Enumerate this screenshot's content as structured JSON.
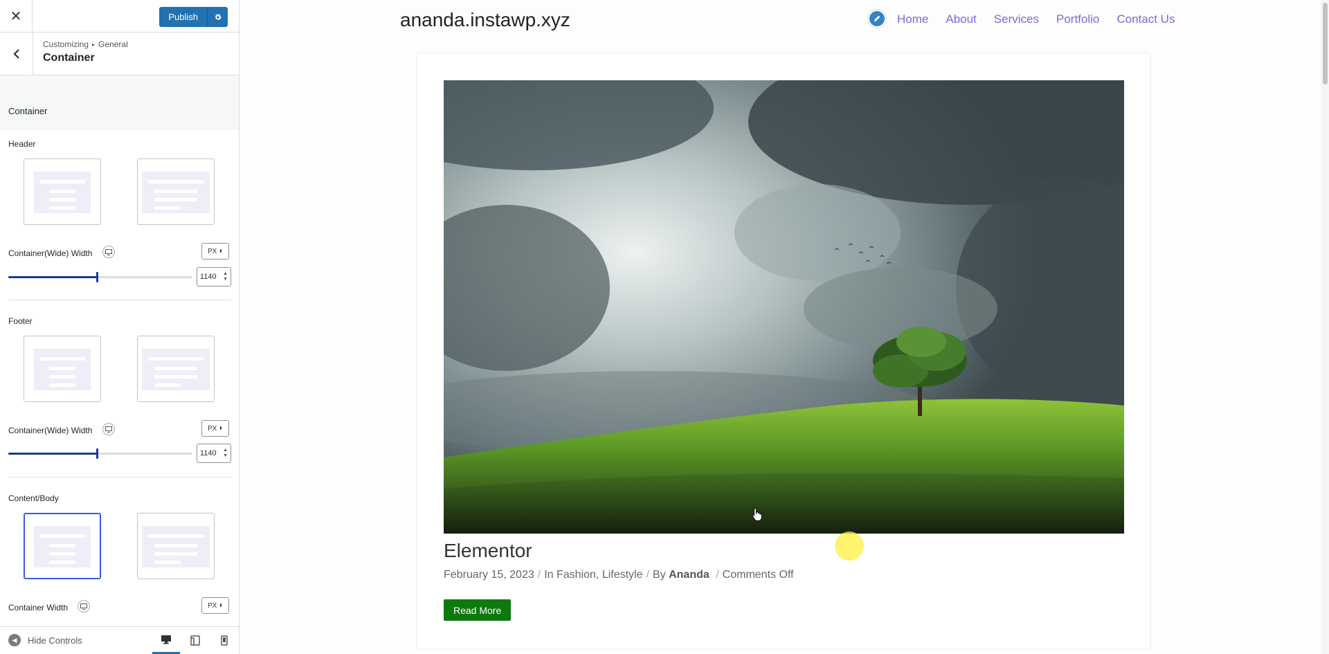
{
  "customizer": {
    "close_icon": "close-icon",
    "publish_label": "Publish",
    "breadcrumb_root": "Customizing",
    "breadcrumb_parent": "General",
    "section_title": "Container",
    "panel_heading": "Container",
    "header": {
      "label": "Header",
      "width_label": "Container(Wide) Width",
      "unit": "PX",
      "value": "1140",
      "slider_fraction": 0.48
    },
    "footer": {
      "label": "Footer",
      "width_label": "Container(Wide) Width",
      "unit": "PX",
      "value": "1140",
      "slider_fraction": 0.48
    },
    "content": {
      "label": "Content/Body",
      "width_label": "Container Width",
      "unit": "PX"
    },
    "hide_controls": "Hide Controls"
  },
  "site": {
    "title": "ananda.instawp.xyz",
    "nav": [
      "Home",
      "About",
      "Services",
      "Portfolio",
      "Contact Us"
    ]
  },
  "post": {
    "title": "Elementor",
    "date": "February 15, 2023",
    "in_prefix": "In",
    "categories": [
      "Fashion",
      "Lifestyle"
    ],
    "by_prefix": "By",
    "author": "Ananda",
    "comments": "Comments Off",
    "read_more": "Read More"
  },
  "colors": {
    "accent": "#2271b1",
    "nav_link": "#7a6ad8",
    "read_more_bg": "#0e7a0e",
    "slider": "#1a3a8f"
  }
}
